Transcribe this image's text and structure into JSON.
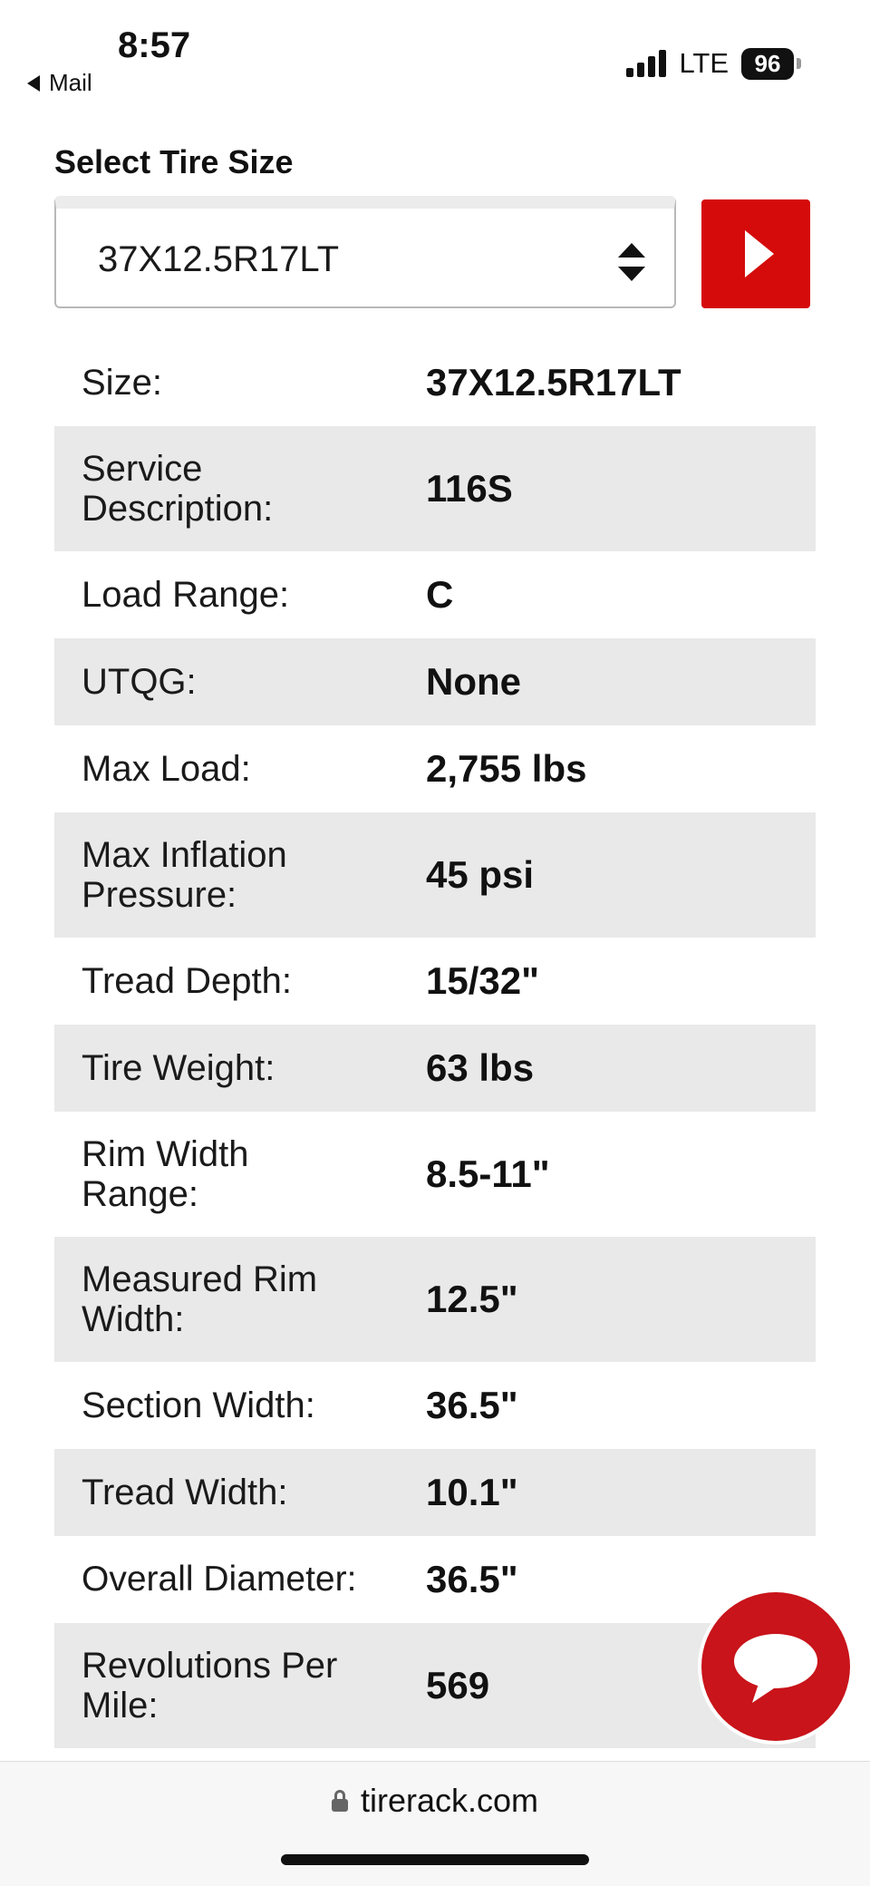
{
  "status_bar": {
    "time": "8:57",
    "back_app": "Mail",
    "network": "LTE",
    "battery": "96"
  },
  "tire_size": {
    "title": "Select Tire Size",
    "selected": "37X12.5R17LT"
  },
  "specs": [
    {
      "label": "Size:",
      "value": "37X12.5R17LT"
    },
    {
      "label": "Service Description:",
      "value": "116S"
    },
    {
      "label": "Load Range:",
      "value": "C"
    },
    {
      "label": "UTQG:",
      "value": "None"
    },
    {
      "label": "Max Load:",
      "value": "2,755 lbs"
    },
    {
      "label": "Max Inflation Pressure:",
      "value": "45 psi"
    },
    {
      "label": "Tread Depth:",
      "value": "15/32\""
    },
    {
      "label": "Tire Weight:",
      "value": "63 lbs"
    },
    {
      "label": "Rim Width Range:",
      "value": "8.5-11\""
    },
    {
      "label": "Measured Rim Width:",
      "value": "12.5\""
    },
    {
      "label": "Section Width:",
      "value": "36.5\""
    },
    {
      "label": "Tread Width:",
      "value": "10.1\""
    },
    {
      "label": "Overall Diameter:",
      "value": "36.5\""
    },
    {
      "label": "Revolutions Per Mile:",
      "value": "569"
    }
  ],
  "browser": {
    "url": "tirerack.com"
  },
  "icons": {
    "go": "play-icon",
    "chat": "chat-bubble-icon",
    "lock": "lock-icon",
    "select": "chevron-updown-icon"
  },
  "colors": {
    "accent": "#d50a0a",
    "row_shade": "#e9e9e9"
  }
}
